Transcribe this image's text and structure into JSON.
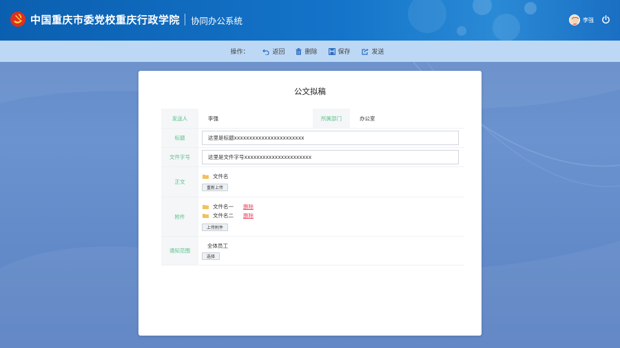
{
  "header": {
    "title": "中国重庆市委党校重庆行政学院",
    "subtitle": "协同办公系统",
    "user_name": "李强"
  },
  "toolbar": {
    "label": "操作：",
    "back": "返回",
    "delete": "删除",
    "save": "保存",
    "send": "发送"
  },
  "form": {
    "title": "公文拟稿",
    "sender_label": "发送人",
    "sender_value": "李强",
    "dept_label": "所属部门",
    "dept_value": "办公室",
    "subject_label": "标题",
    "subject_value": "这里是标题xxxxxxxxxxxxxxxxxxxxxxx",
    "docno_label": "文件字号",
    "docno_value": "这里是文件字号xxxxxxxxxxxxxxxxxxxxxx",
    "body_label": "正文",
    "body_file": "文件名",
    "reupload": "重新上传",
    "attach_label": "附件",
    "attachments": [
      {
        "name": "文件名一",
        "delete": "删除"
      },
      {
        "name": "文件名二",
        "delete": "删除"
      }
    ],
    "upload_attach": "上传附件",
    "scope_label": "通知范围",
    "scope_value": "全体员工",
    "choose": "选择"
  },
  "colors": {
    "header_blue": "#1474c9",
    "toolbar_bg": "#bcd8f5",
    "label_green": "#5cc08a",
    "delete_red": "#e8445e",
    "folder_yellow": "#f2c15a"
  }
}
